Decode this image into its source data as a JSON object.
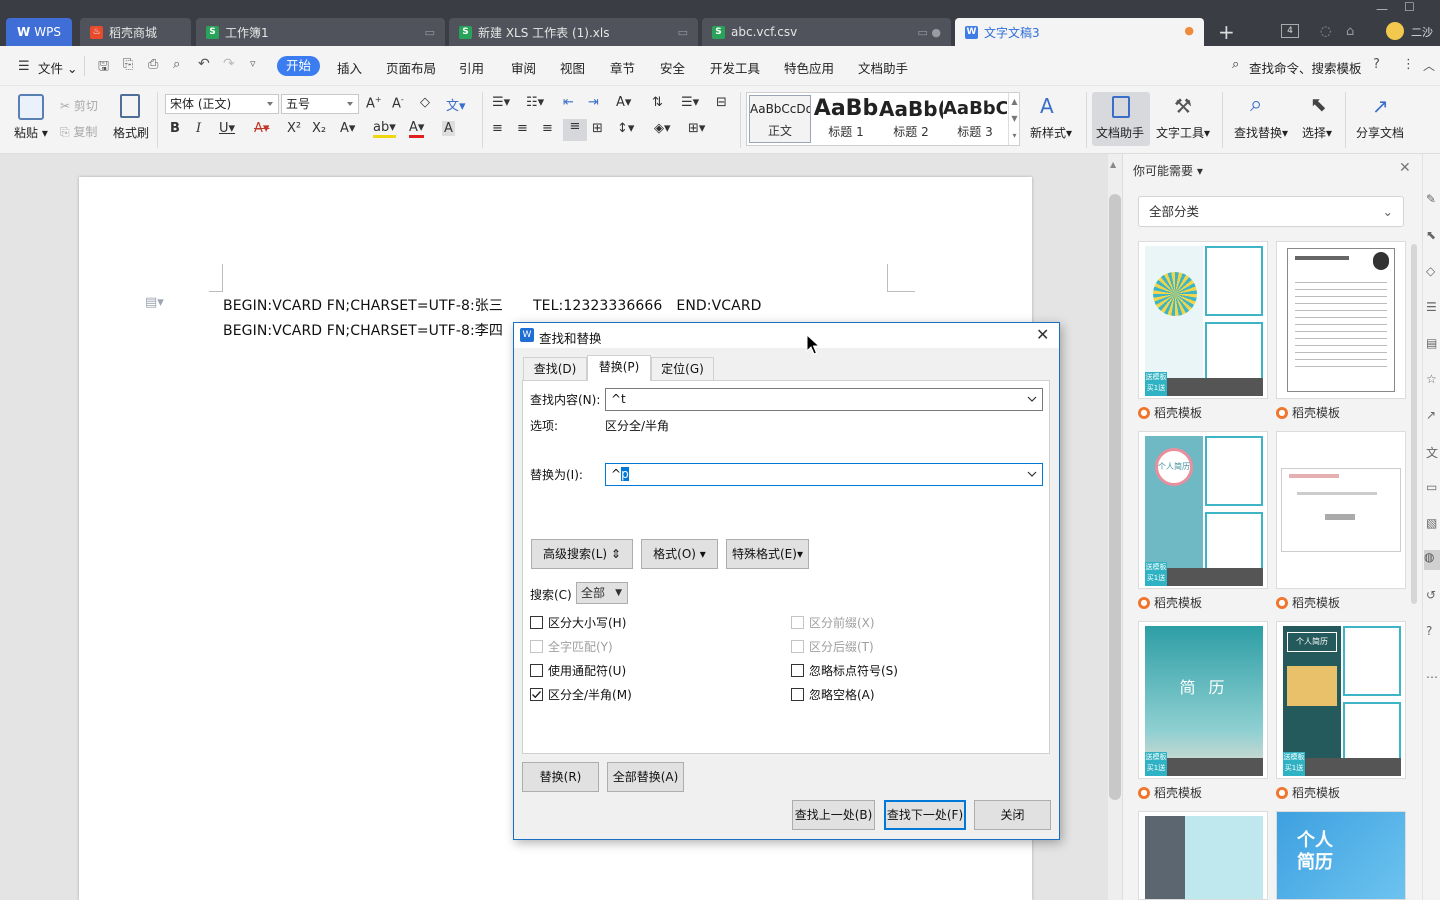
{
  "tabs": {
    "wps": "WPS",
    "t1": "稻壳商城",
    "t2": "工作簿1",
    "t3": "新建 XLS 工作表 (1).xls",
    "t4": "abc.vcf.csv",
    "t5": "文字文稿3",
    "window_user": "二沙"
  },
  "menu": {
    "file": "文件",
    "start": "开始",
    "insert": "插入",
    "layout": "页面布局",
    "reference": "引用",
    "review": "审阅",
    "view": "视图",
    "chapter": "章节",
    "security": "安全",
    "dev": "开发工具",
    "special": "特色应用",
    "assistant": "文档助手",
    "search": "查找命令、搜索模板"
  },
  "ribbon": {
    "paste": "粘贴",
    "cut": "剪切",
    "copy": "复制",
    "format_painter": "格式刷",
    "font": "宋体 (正文)",
    "size": "五号",
    "styles": [
      {
        "preview": "AaBbCcDd",
        "name": "正文"
      },
      {
        "preview": "AaBb",
        "name": "标题 1"
      },
      {
        "preview": "AaBb(",
        "name": "标题 2"
      },
      {
        "preview": "AaBbC",
        "name": "标题 3"
      }
    ],
    "new_style": "新样式",
    "doc_assistant": "文档助手",
    "text_tools": "文字工具",
    "find_replace": "查找替换",
    "select": "选择",
    "share": "分享文档"
  },
  "document": {
    "line1_a": "BEGIN:VCARD FN;CHARSET=UTF-8:张三",
    "line1_b": "TEL:12323336666",
    "line1_c": "END:VCARD",
    "line2_a": "BEGIN:VCARD FN;CHARSET=UTF-8:李四"
  },
  "panel": {
    "title": "你可能需要",
    "category": "全部分类",
    "template_label": "稻壳模板",
    "badge_main": "送模板",
    "badge_sub": "买1送3",
    "resume_cn": "简 历",
    "resume_vert": "个人简历"
  },
  "dialog": {
    "title": "查找和替换",
    "tab_find": "查找(D)",
    "tab_replace": "替换(P)",
    "tab_goto": "定位(G)",
    "find_label": "查找内容(N):",
    "find_value": "^t",
    "options_label": "选项:",
    "options_value": "区分全/半角",
    "replace_label": "替换为(I):",
    "replace_value_a": "^",
    "replace_value_sel": "p",
    "btn_advanced": "高级搜索(L)",
    "btn_format": "格式(O)",
    "btn_special": "特殊格式(E)",
    "search_label": "搜索(C)",
    "search_value": "全部",
    "cb_case": "区分大小写(H)",
    "cb_whole": "全字匹配(Y)",
    "cb_wildcard": "使用通配符(U)",
    "cb_width": "区分全/半角(M)",
    "cb_prefix": "区分前缀(X)",
    "cb_suffix": "区分后缀(T)",
    "cb_punct": "忽略标点符号(S)",
    "cb_space": "忽略空格(A)",
    "btn_replace": "替换(R)",
    "btn_replace_all": "全部替换(A)",
    "btn_prev": "查找上一处(B)",
    "btn_next": "查找下一处(F)",
    "btn_close": "关闭"
  }
}
